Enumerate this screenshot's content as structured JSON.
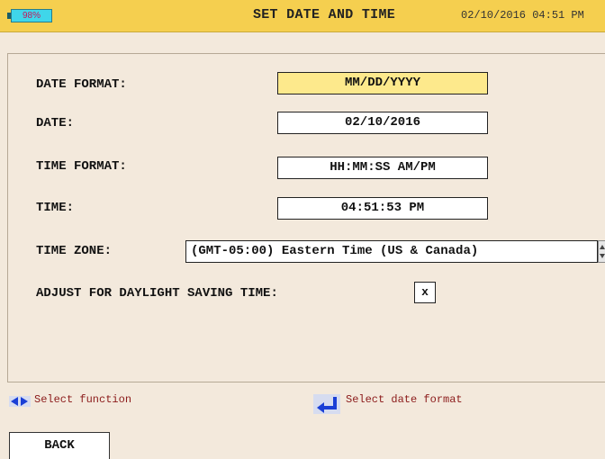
{
  "header": {
    "battery": "98%",
    "title": "SET DATE AND TIME",
    "datetime": "02/10/2016 04:51 PM"
  },
  "form": {
    "date_format": {
      "label": "DATE FORMAT:",
      "value": "MM/DD/YYYY"
    },
    "date": {
      "label": "DATE:",
      "value": "02/10/2016"
    },
    "time_format": {
      "label": "TIME FORMAT:",
      "value": "HH:MM:SS AM/PM"
    },
    "time": {
      "label": "TIME:",
      "value": "04:51:53 PM"
    },
    "time_zone": {
      "label": "TIME ZONE:",
      "value": "(GMT-05:00) Eastern Time (US & Canada)"
    },
    "dst": {
      "label": "ADJUST FOR DAYLIGHT SAVING TIME:",
      "value": "x"
    }
  },
  "hints": {
    "left": "Select function",
    "right": "Select date format"
  },
  "footer": {
    "back_label": "BACK"
  },
  "colors": {
    "header_bg": "#f5cf4f",
    "selected_field": "#fde98c",
    "hint_text": "#8b1a1a",
    "icon_blue": "#1a3fd6"
  },
  "icons": {
    "battery": "battery-icon",
    "left_right": "left-right-arrows-icon",
    "enter": "enter-icon"
  }
}
